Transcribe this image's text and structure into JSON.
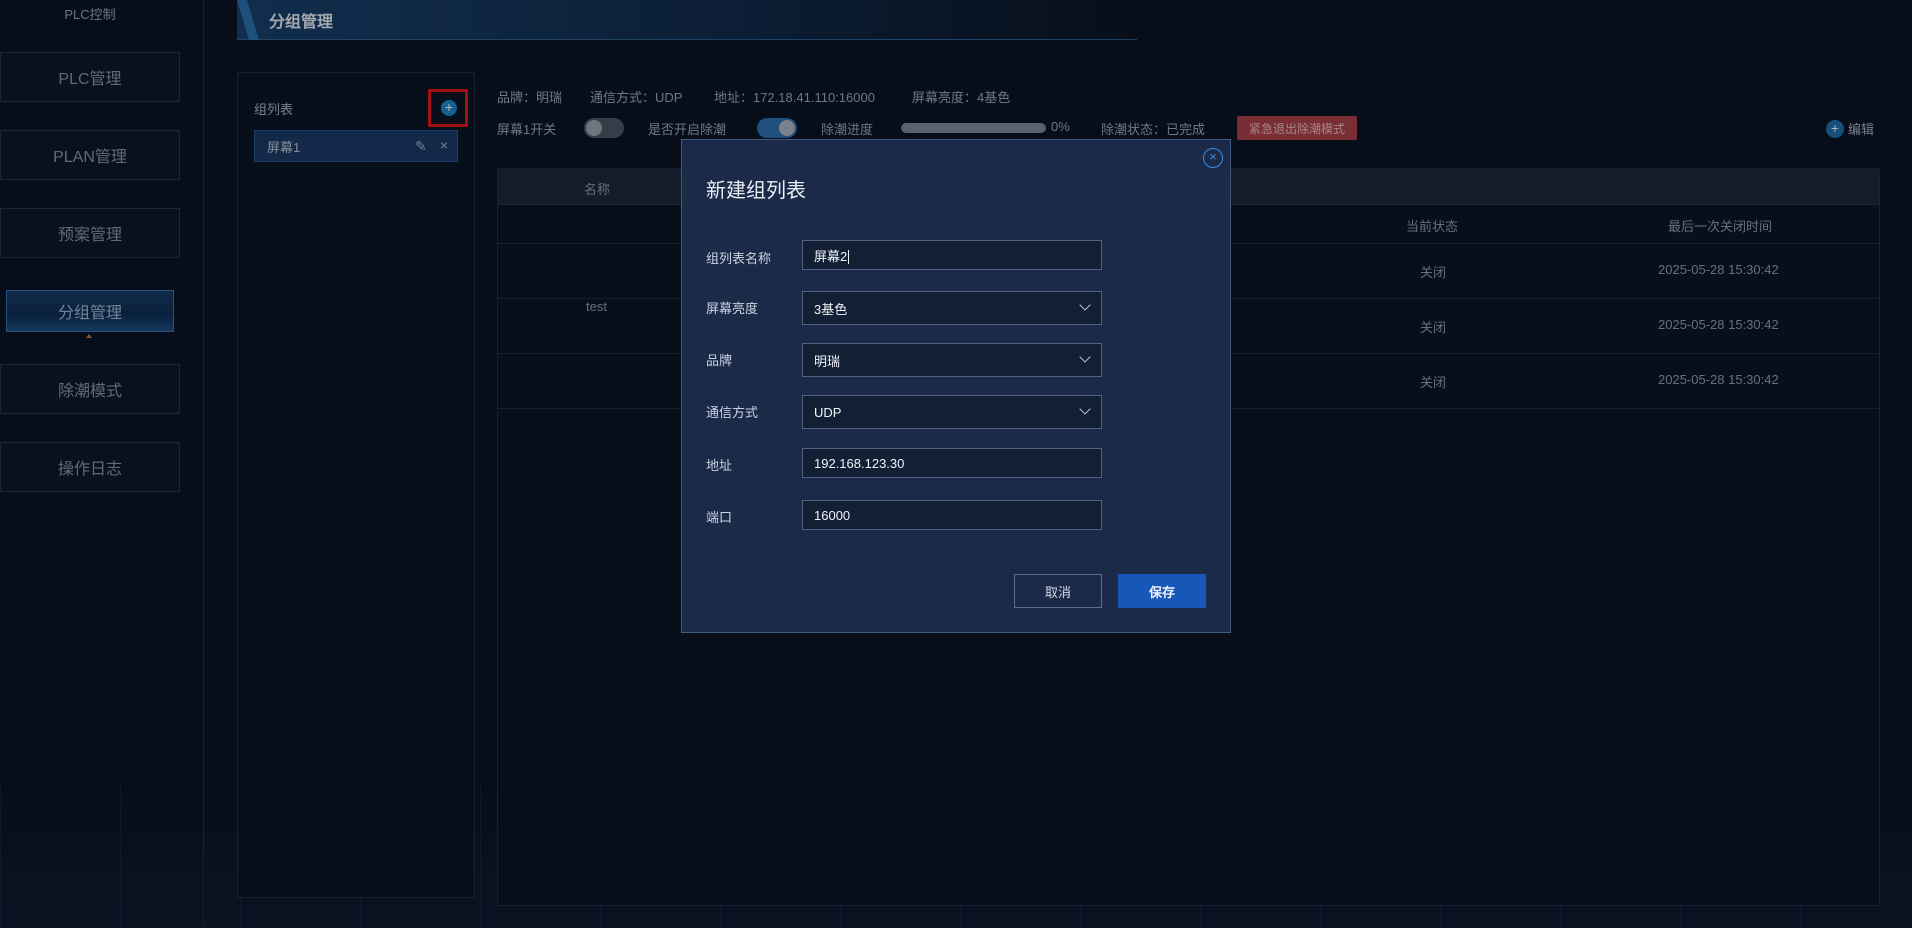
{
  "sidebar": {
    "brand": "PLC控制",
    "items": [
      {
        "label": "PLC管理"
      },
      {
        "label": "PLAN管理"
      },
      {
        "label": "预案管理"
      },
      {
        "label": "分组管理"
      },
      {
        "label": "除潮模式"
      },
      {
        "label": "操作日志"
      }
    ]
  },
  "header": {
    "title": "分组管理"
  },
  "group_panel": {
    "label": "组列表",
    "add_icon": "+",
    "items": [
      {
        "label": "屏幕1"
      }
    ]
  },
  "info": {
    "brand": "品牌：明瑞",
    "comm": "通信方式：UDP",
    "address": "地址：172.18.41.110:16000",
    "brightness": "屏幕亮度：4基色"
  },
  "controls": {
    "screen_switch_label": "屏幕1开关",
    "screen_switch_on": false,
    "dehumid_enable_label": "是否开启除潮",
    "dehumid_enable_on": true,
    "progress_label": "除潮进度",
    "progress_value": 0,
    "progress_text": "0%",
    "status_text": "除潮状态：已完成",
    "emergency_button": "紧急退出除潮模式",
    "edit_label": "编辑"
  },
  "table": {
    "columns": [
      "名称",
      "当前状态",
      "最后一次关闭时间"
    ],
    "group_name": "test",
    "rows": [
      {
        "status": "关闭",
        "last_closed": "2025-05-28 15:30:42"
      },
      {
        "status": "关闭",
        "last_closed": "2025-05-28 15:30:42"
      },
      {
        "status": "关闭",
        "last_closed": "2025-05-28 15:30:42"
      }
    ]
  },
  "modal": {
    "title": "新建组列表",
    "close_icon": "×",
    "fields": {
      "name_label": "组列表名称",
      "name_value": "屏幕2",
      "brightness_label": "屏幕亮度",
      "brightness_value": "3基色",
      "brand_label": "品牌",
      "brand_value": "明瑞",
      "comm_label": "通信方式",
      "comm_value": "UDP",
      "address_label": "地址",
      "address_value": "192.168.123.30",
      "port_label": "端口",
      "port_value": "16000"
    },
    "cancel_label": "取消",
    "save_label": "保存"
  },
  "colors": {
    "background": "#0b1424",
    "accent": "#1657b8",
    "danger": "#a94148",
    "highlight_frame": "#e11919"
  }
}
